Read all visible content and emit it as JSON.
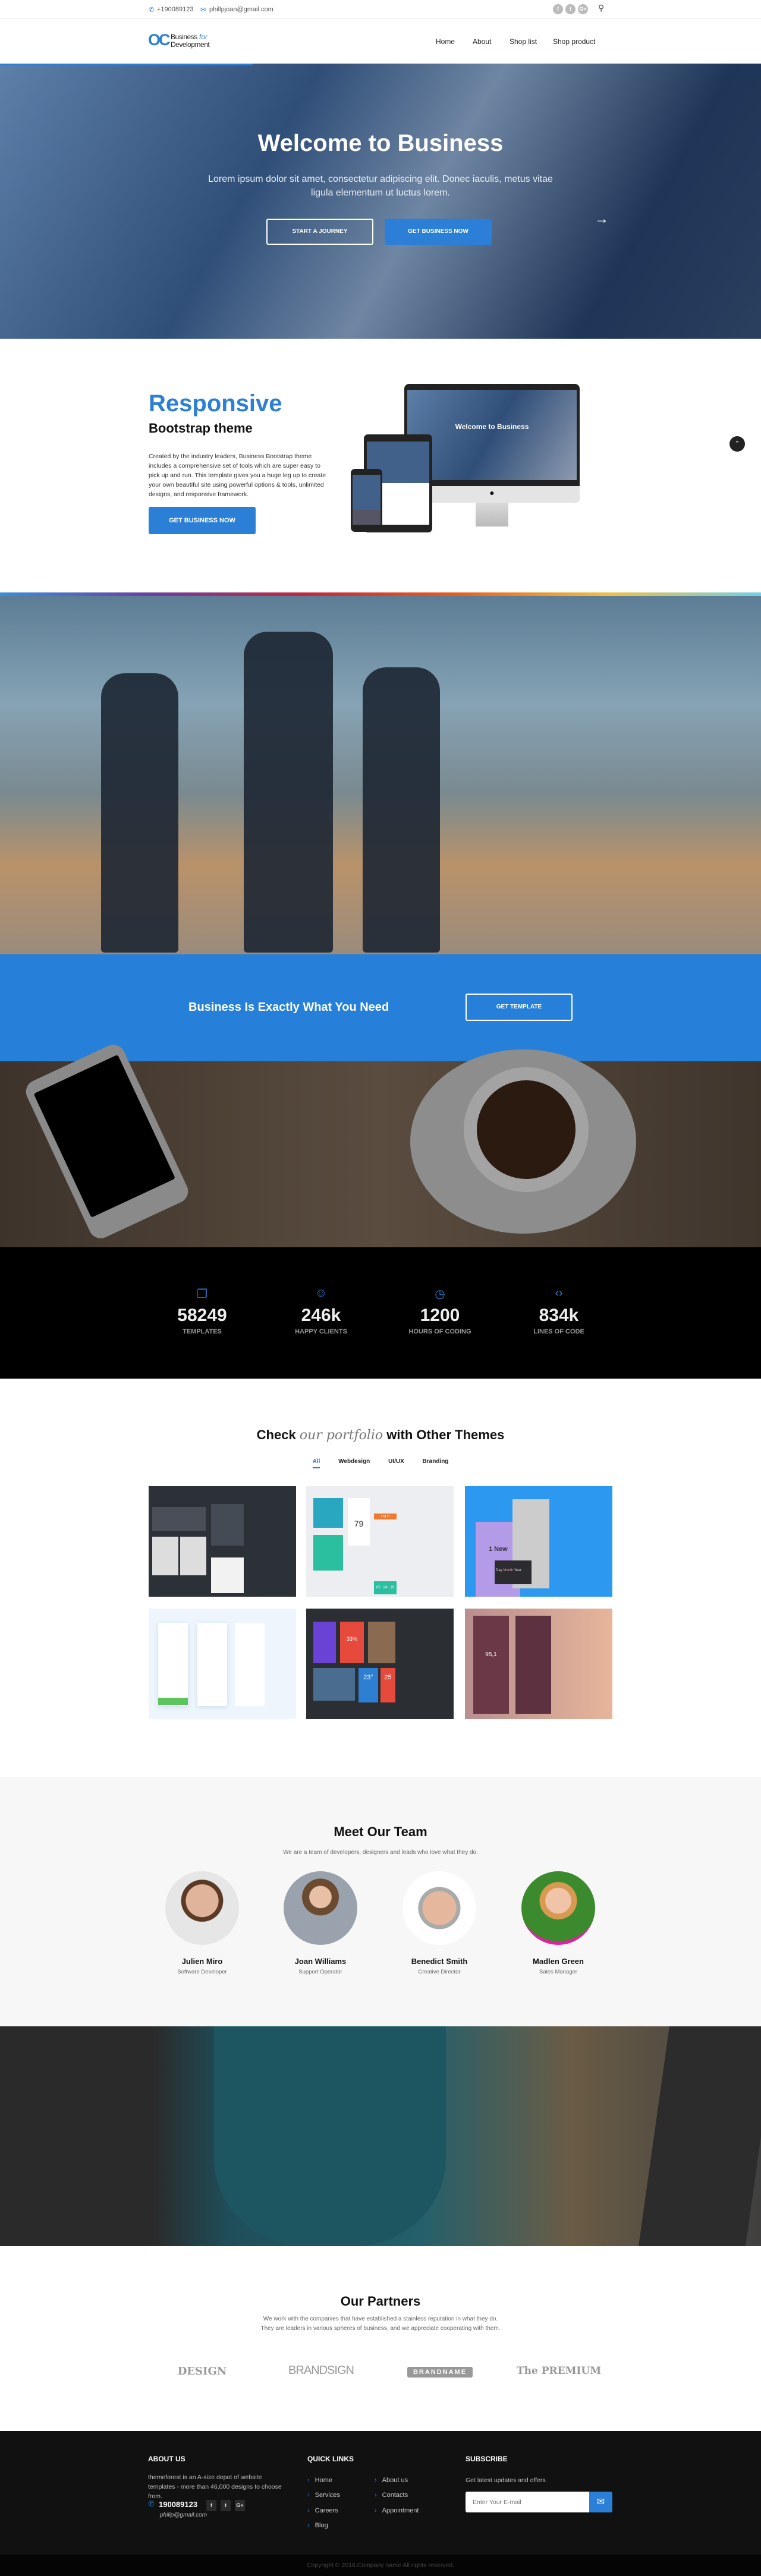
{
  "colors": {
    "accent": "#2b7fd6",
    "cta_band": "#2680d9",
    "stats_bg": "#000000",
    "footer_bg": "#111111"
  },
  "topbar": {
    "phone": "+190089123",
    "email": "phillpjoan@gmail.com",
    "social": [
      "f",
      "t",
      "G+"
    ],
    "phone_icon": "phone-icon",
    "email_icon": "envelope-icon",
    "search_icon": "search-icon"
  },
  "header": {
    "logo": {
      "line1": "Business",
      "for": "for",
      "line2": "Development",
      "mark": "OC"
    },
    "nav": [
      "Home",
      "About",
      "Shop list",
      "Shop product"
    ]
  },
  "hero": {
    "title": "Welcome to Business",
    "subtitle": "Lorem ipsum dolor sit amet, consectetur adipiscing elit. Donec iaculis, metus vitae ligula elementum ut luctus lorem.",
    "btn_journey": "START A JOURNEY",
    "btn_business": "GET BUSINESS NOW",
    "next_icon": "arrow-right-icon"
  },
  "responsive": {
    "title": "Responsive",
    "subtitle": "Bootstrap theme",
    "text": "Created by the industry leaders, Business Bootstrap theme includes a comprehensive set of tools which are super easy to pick up and run. This template gives you a huge leg up to create your own beautiful site using powerful options & tools, unlimited designs, and responsive framework.",
    "button": "GET BUSINESS NOW",
    "mock_title": "Welcome to Business"
  },
  "cta": {
    "text": "Business Is Exactly What You Need",
    "button": "GET TEMPLATE"
  },
  "stats": [
    {
      "icon": "copy-icon",
      "value": "58249",
      "label": "TEMPLATES"
    },
    {
      "icon": "smile-icon",
      "value": "246k",
      "label": "HAPPY CLIENTS"
    },
    {
      "icon": "clock-icon",
      "value": "1200",
      "label": "HOURS OF CODING"
    },
    {
      "icon": "code-icon",
      "value": "834k",
      "label": "LINES OF CODE"
    }
  ],
  "portfolio": {
    "title_a": "Check",
    "title_em": "our portfolio",
    "title_b": "with Other Themes",
    "tabs": [
      "All",
      "Webdesign",
      "UI/UX",
      "Branding"
    ],
    "active_tab": "All",
    "tile_texts": {
      "t2_gauge": "79",
      "t2_timer": "05 : 24 : 19",
      "t2_login": "Log In",
      "t3_new": "1 New",
      "t3_day": "Day",
      "t3_month": "Month",
      "t3_year": "Year",
      "t5_pct": "33%",
      "t5_temp": "23°",
      "t5_date": "25",
      "t6_radio": "95,1"
    }
  },
  "team": {
    "title": "Meet Our Team",
    "subtitle": "We are a team of developers, designers and leads who love what they do.",
    "members": [
      {
        "name": "Julien Miro",
        "role": "Software Developer"
      },
      {
        "name": "Joan Williams",
        "role": "Support Operator"
      },
      {
        "name": "Benedict Smith",
        "role": "Creative Director"
      },
      {
        "name": "Madlen Green",
        "role": "Sales Manager"
      }
    ]
  },
  "partners": {
    "title": "Our Partners",
    "line1": "We work with the companies that have established a stainless reputation in what they do.",
    "line2": "They are leaders in various spheres of business, and we appreciate cooperating with them.",
    "logos": [
      "DESIGN",
      "BRANDSIGN",
      "BRANDNAME",
      "The PREMIUM"
    ]
  },
  "footer": {
    "about_title": "ABOUT US",
    "about_text": "themeforest is an A-size depot of website templates - more than 46,000 designs to choose from.",
    "phone": "190089123",
    "email": "philip@gmail.com",
    "social": [
      "f",
      "t",
      "G+"
    ],
    "links_title": "QUICK LINKS",
    "links_col1": [
      "Home",
      "Services",
      "Careers",
      "Blog"
    ],
    "links_col2": [
      "About us",
      "Contacts",
      "Appointment"
    ],
    "subscribe_title": "SUBSCRIBE",
    "subscribe_text": "Get latest updates and offers.",
    "email_placeholder": "Enter Your E-mail",
    "copyright": "Copyright © 2018.Company name All rights reserved."
  }
}
